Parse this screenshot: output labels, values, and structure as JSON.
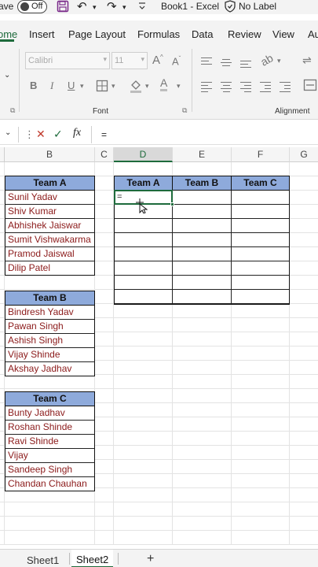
{
  "titlebar": {
    "autosave_label": "ave",
    "toggle_label": "Off",
    "title": "Book1  -  Excel",
    "sensitivity": "No Label"
  },
  "tabs": [
    "ome",
    "Insert",
    "Page Layout",
    "Formulas",
    "Data",
    "Review",
    "View",
    "Au"
  ],
  "ribbon": {
    "font_name": "Calibri",
    "font_size": "11",
    "font_group_label": "Font",
    "alignment_group_label": "Alignment"
  },
  "formula_bar": {
    "cancel_symbol": "✕",
    "enter_symbol": "✓",
    "fx_label": "fx",
    "content": "="
  },
  "columns": [
    "B",
    "C",
    "D",
    "E",
    "F",
    "G"
  ],
  "active_column": "D",
  "team_a": {
    "header": "Team A",
    "members": [
      "Sunil Yadav",
      "Shiv Kumar",
      "Abhishek Jaiswar",
      "Sumit Vishwakarma",
      "Pramod Jaiswal",
      "Dilip Patel"
    ]
  },
  "team_b": {
    "header": "Team B",
    "members": [
      "Bindresh Yadav",
      "Pawan Singh",
      "Ashish Singh",
      "Vijay Shinde",
      "Akshay Jadhav"
    ]
  },
  "team_c": {
    "header": "Team C",
    "members": [
      "Bunty Jadhav",
      "Roshan Shinde",
      "Ravi Shinde",
      "Vijay",
      "Sandeep Singh",
      "Chandan Chauhan"
    ]
  },
  "target_table": {
    "headers": [
      "Team A",
      "Team B",
      "Team C"
    ],
    "active_cell_value": "="
  },
  "sheets": {
    "sheet1": "Sheet1",
    "sheet2": "Sheet2",
    "add": "+"
  },
  "colors": {
    "accent": "#1e6b3c",
    "header_fill": "#8eaadb",
    "name_text": "#8b1a1a"
  }
}
